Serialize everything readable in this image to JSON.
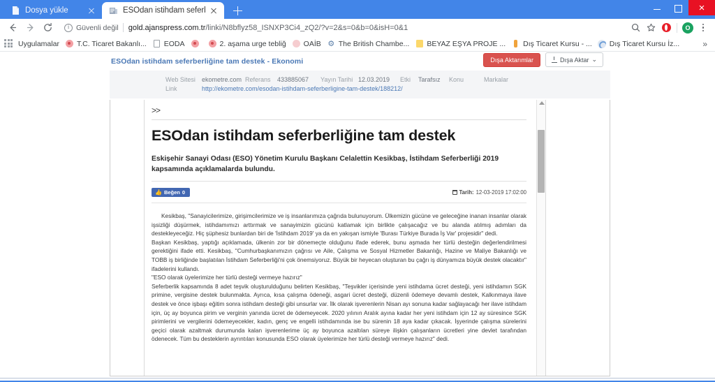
{
  "browser": {
    "tabs": [
      {
        "title": "Dosya yükle",
        "favicon": "document-icon",
        "active": false
      },
      {
        "title": "ESOdan istihdam seferberliğine t",
        "favicon": "news-icon",
        "active": true
      }
    ],
    "new_tab_label": "+",
    "window_controls": {
      "minimize": "–",
      "maximize": "❐",
      "close": "×"
    },
    "nav": {
      "back": "←",
      "forward": "→",
      "reload": "⟳"
    },
    "omnibox": {
      "security_text": "Güvenli değil",
      "url_host": "gold.ajanspress.com.tr",
      "url_path": "/linki/N8bflyz58_ISNXP3Ci4_zQ2/?v=2&s=0&b=0&isH=0&1",
      "url_full": "gold.ajanspress.com.tr/linki/N8bflyz58_ISNXP3Ci4_zQ2/?v=2&s=0&b=0&isH=0&1"
    },
    "toolbar_icons": [
      "search-icon",
      "star-icon",
      "opera-extension-icon",
      "profile-avatar",
      "kebab-menu-icon"
    ],
    "profile_initial": "O",
    "bookmarks": {
      "apps_label": "Uygulamalar",
      "items": [
        {
          "label": "T.C. Ticaret Bakanlı...",
          "icon": "red-dot-favicon"
        },
        {
          "label": "EODA",
          "icon": "document-favicon"
        },
        {
          "label": "",
          "icon": "red-dot-favicon"
        },
        {
          "label": "2. aşama urge tebliğ",
          "icon": "red-dot-favicon"
        },
        {
          "label": "OAİB",
          "icon": "pink-swoosh-favicon"
        },
        {
          "label": "The British Chambe...",
          "icon": "gear-favicon"
        },
        {
          "label": "BEYAZ EŞYA PROJE ...",
          "icon": "yellow-note-favicon"
        },
        {
          "label": "Dış Ticaret Kursu - ...",
          "icon": "orange-bar-favicon"
        },
        {
          "label": "Dış Ticaret Kursu İz...",
          "icon": "blue-circle-favicon"
        }
      ],
      "overflow_label": "»"
    }
  },
  "page": {
    "title": "ESOdan istihdam seferberliğine tam destek - Ekonomi",
    "actions": {
      "exports_label": "Dışa Aktarımlar",
      "export_label": "Dışa Aktar",
      "export_caret": "⌄"
    },
    "meta": {
      "websitesi_label": "Web Sitesi",
      "websitesi_value": "ekometre.com",
      "referans_label": "Referans",
      "referans_value": "433885067",
      "yayin_tarihi_label": "Yayın Tarihi",
      "yayin_tarihi_value": "12.03.2019",
      "etki_label": "Etki",
      "tarafsiz_label": "Tarafsız",
      "konu_label": "Konu",
      "markalar_label": "Markalar",
      "link_label": "Link",
      "link_url": "http://ekometre.com/esodan-istihdam-seferberligine-tam-destek/188212/"
    },
    "article": {
      "chevron": ">>",
      "headline": "ESOdan istihdam seferberliğine tam destek",
      "lead": "Eskişehir Sanayi Odası (ESO) Yönetim Kurulu Başkanı Celalettin Kesikbaş, İstihdam Seferberliği 2019 kapsamında açıklamalarda bulundu.",
      "fb_like_label": "Beğen",
      "fb_like_count": "0",
      "date_label": "Tarih:",
      "date_value": "12-03-2019 17:02:00",
      "paragraphs": [
        "Kesikbaş, \"Sanayicilerimize, girişimcilerimize ve iş insanlarımıza çağrıda bulunuyorum. Ülkemizin gücüne ve geleceğine inanan insanlar olarak işsizliği düşürmek, istihdamımızı arttırmak ve sanayimizin gücünü katlamak için birlikte çalışacağız ve bu alanda atılmış adımları da destekleyeceğiz. Hiç şüphesiz bunlardan biri de 'İstihdam 2019' ya da en yakışan ismiyle 'Burası Türkiye Burada İş Var' projesidir\" dedi.",
        "Başkan Kesikbaş, yaptığı açıklamada, ülkenin zor bir dönemeçte olduğunu ifade ederek, bunu aşmada her türlü desteğin değerlendirilmesi gerektiğini ifade etti. Kesikbaş, \"Cumhurbaşkanımızın çağrısı ve Aile, Çalışma ve Sosyal Hizmetler Bakanlığı, Hazine ve Maliye Bakanlığı ve TOBB iş birliğinde başlatılan İstihdam Seferberliği'ni çok önemsiyoruz. Büyük bir heyecan oluşturan bu çağrı iş dünyamıza büyük destek olacaktır\" ifadelerini kullandı.",
        "\"ESO olarak üyelerimize her türlü desteği vermeye hazırız\"",
        "Seferberlik kapsamında 8 adet teşvik oluşturulduğunu belirten Kesikbaş, \"Teşvikler içerisinde yeni istihdama ücret desteği, yeni istihdamın SGK primine, vergisine destek bulunmakta. Ayrıca, kısa çalışma ödeneği, asgari ücret desteği, düzenli ödemeye devamlı destek, Kalkınmaya ilave destek ve önce işbaşı eğitim sonra istihdam desteği gibi unsurlar var. İlk olarak işverenlerin Nisan ayı sonuna kadar sağlayacağı her ilave istihdam için, üç ay boyunca pirim ve verginin yanında ücret de ödemeyecek. 2020 yılının Aralık ayına kadar her yeni istihdam için 12 ay süresince SGK pirimlerini ve vergilerini ödemeyecekler, kadın, genç ve engelli istihdamında ise bu sürenin 18 aya kadar çıkacak. İşyerinde çalışma sürelerini geçici olarak azaltmak durumunda kalan işverenlerime üç ay boyunca azaltılan süreye ilişkin çalışanların ücretleri yine devlet tarafından ödenecek. Tüm bu desteklerin ayrıntıları konusunda ESO olarak üyelerimize her türlü desteği vermeye hazırız\" dedi."
      ]
    }
  }
}
